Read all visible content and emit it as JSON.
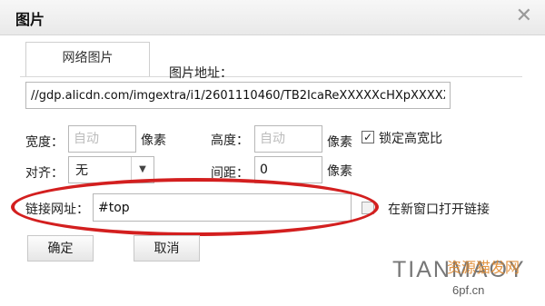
{
  "dialog": {
    "title": "图片",
    "tab_label": "网络图片",
    "url_label": "图片地址：",
    "url_value": "//gdp.alicdn.com/imgextra/i1/2601110460/TB2IcaReXXXXXcHXpXXXXX",
    "width_label": "宽度：",
    "width_placeholder": "自动",
    "width_unit": "像素",
    "height_label": "高度：",
    "height_placeholder": "自动",
    "height_unit": "像素",
    "lock_ratio_label": "锁定高宽比",
    "lock_ratio_checked": true,
    "align_label": "对齐：",
    "align_value": "无",
    "spacing_label": "间距：",
    "spacing_value": "0",
    "spacing_unit": "像素",
    "link_label": "链接网址：",
    "link_value": "#top",
    "new_window_label": "在新窗口打开链接",
    "new_window_checked": false,
    "ok_button": "确定",
    "cancel_button": "取消"
  },
  "watermark": {
    "latin": "TIANMAOY",
    "chinese": "资源猫发网",
    "url": "6pf.cn"
  },
  "colors": {
    "highlight_ellipse": "#d31f1f",
    "title_bar": "#ececec"
  }
}
